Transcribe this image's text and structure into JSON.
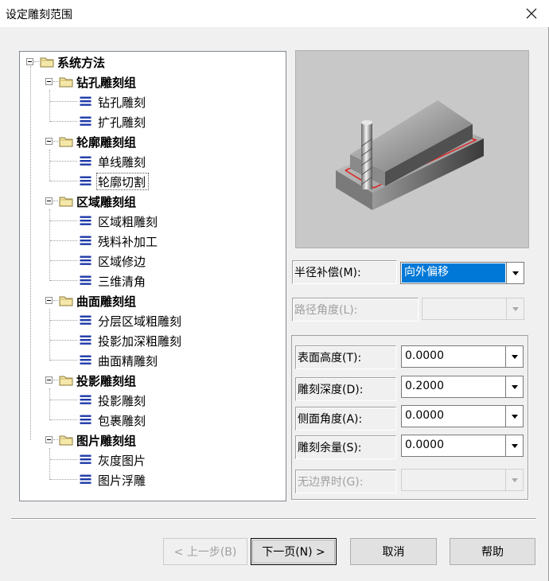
{
  "window": {
    "title": "设定雕刻范围"
  },
  "tree": {
    "root": "系统方法",
    "groups": [
      {
        "label": "钻孔雕刻组",
        "items": [
          "钻孔雕刻",
          "扩孔雕刻"
        ]
      },
      {
        "label": "轮廓雕刻组",
        "items": [
          "单线雕刻",
          "轮廓切割"
        ]
      },
      {
        "label": "区域雕刻组",
        "items": [
          "区域粗雕刻",
          "残料补加工",
          "区域修边",
          "三维清角"
        ]
      },
      {
        "label": "曲面雕刻组",
        "items": [
          "分层区域粗雕刻",
          "投影加深粗雕刻",
          "曲面精雕刻"
        ]
      },
      {
        "label": "投影雕刻组",
        "items": [
          "投影雕刻",
          "包裹雕刻"
        ]
      },
      {
        "label": "图片雕刻组",
        "items": [
          "灰度图片",
          "图片浮雕"
        ]
      }
    ],
    "selected": "轮廓切割"
  },
  "form": {
    "radius_comp": {
      "label": "半径补偿(M):",
      "value": "向外偏移"
    },
    "path_angle": {
      "label": "路径角度(L):",
      "value": ""
    },
    "surface_height": {
      "label": "表面高度(T):",
      "value": "0.0000"
    },
    "engrave_depth": {
      "label": "雕刻深度(D):",
      "value": "0.2000"
    },
    "side_angle": {
      "label": "侧面角度(A):",
      "value": "0.0000"
    },
    "engrave_allowance": {
      "label": "雕刻余量(S):",
      "value": "0.0000"
    },
    "no_border": {
      "label": "无边界时(G):",
      "value": ""
    }
  },
  "buttons": {
    "prev": "< 上一步(B)",
    "next": "下一页(N) >",
    "cancel": "取消",
    "help": "帮助"
  },
  "colors": {
    "selection": "#0078d7",
    "toolpath": "#e02020",
    "leaf_icon": "#1e3aa8"
  },
  "icons": {
    "close": "close-icon",
    "folder": "folder-icon",
    "leaf": "method-icon"
  }
}
